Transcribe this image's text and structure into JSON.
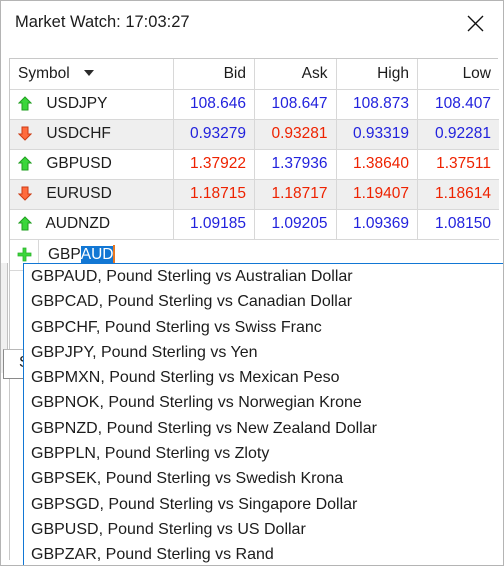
{
  "window": {
    "title": "Market Watch: 17:03:27",
    "close_icon": "close-icon"
  },
  "table": {
    "columns": [
      {
        "key": "symbol",
        "label": "Symbol",
        "sort_icon": "chevron-down-icon"
      },
      {
        "key": "bid",
        "label": "Bid"
      },
      {
        "key": "ask",
        "label": "Ask"
      },
      {
        "key": "high",
        "label": "High"
      },
      {
        "key": "low",
        "label": "Low"
      }
    ],
    "rows": [
      {
        "symbol": "USDJPY",
        "trend": "up",
        "trend_icon": "arrow-up-icon",
        "bid": "108.646",
        "bid_dir": "up",
        "ask": "108.647",
        "ask_dir": "up",
        "high": "108.873",
        "high_dir": "up",
        "low": "108.407",
        "low_dir": "up"
      },
      {
        "symbol": "USDCHF",
        "trend": "down",
        "trend_icon": "arrow-down-icon",
        "bid": "0.93279",
        "bid_dir": "up",
        "ask": "0.93281",
        "ask_dir": "down",
        "high": "0.93319",
        "high_dir": "up",
        "low": "0.92281",
        "low_dir": "up"
      },
      {
        "symbol": "GBPUSD",
        "trend": "up",
        "trend_icon": "arrow-up-icon",
        "bid": "1.37922",
        "bid_dir": "down",
        "ask": "1.37936",
        "ask_dir": "up",
        "high": "1.38640",
        "high_dir": "down",
        "low": "1.37511",
        "low_dir": "down"
      },
      {
        "symbol": "EURUSD",
        "trend": "down",
        "trend_icon": "arrow-down-icon",
        "bid": "1.18715",
        "bid_dir": "down",
        "ask": "1.18717",
        "ask_dir": "down",
        "high": "1.19407",
        "high_dir": "down",
        "low": "1.18614",
        "low_dir": "down"
      },
      {
        "symbol": "AUDNZD",
        "trend": "up",
        "trend_icon": "arrow-up-icon",
        "bid": "1.09185",
        "bid_dir": "up",
        "ask": "1.09205",
        "ask_dir": "up",
        "high": "1.09369",
        "high_dir": "up",
        "low": "1.08150",
        "low_dir": "up"
      }
    ]
  },
  "new_symbol_row": {
    "add_icon": "plus-icon",
    "typed_text": "GBP",
    "completion_text": "AUD",
    "full_value": "GBPAUD",
    "placeholder": ""
  },
  "background_tab": {
    "label": "S"
  },
  "autocomplete": {
    "items": [
      "GBPAUD, Pound Sterling vs Australian Dollar",
      "GBPCAD, Pound Sterling vs Canadian Dollar",
      "GBPCHF, Pound Sterling vs Swiss Franc",
      "GBPJPY, Pound Sterling vs Yen",
      "GBPMXN, Pound Sterling vs Mexican Peso",
      "GBPNOK, Pound Sterling vs Norwegian Krone",
      "GBPNZD, Pound Sterling vs New Zealand Dollar",
      "GBPPLN, Pound Sterling vs Zloty",
      "GBPSEK, Pound Sterling vs Swedish Krona",
      "GBPSGD, Pound Sterling vs Singapore Dollar",
      "GBPUSD, Pound Sterling vs US Dollar",
      "GBPZAR, Pound Sterling vs Rand"
    ]
  },
  "colors": {
    "price_up": "#2222dd",
    "price_down": "#ee2200",
    "selection": "#1277d4",
    "caret": "#e87722",
    "row_alt": "#efefef",
    "arrow_up": "#33cc33",
    "arrow_down": "#ee5533"
  }
}
